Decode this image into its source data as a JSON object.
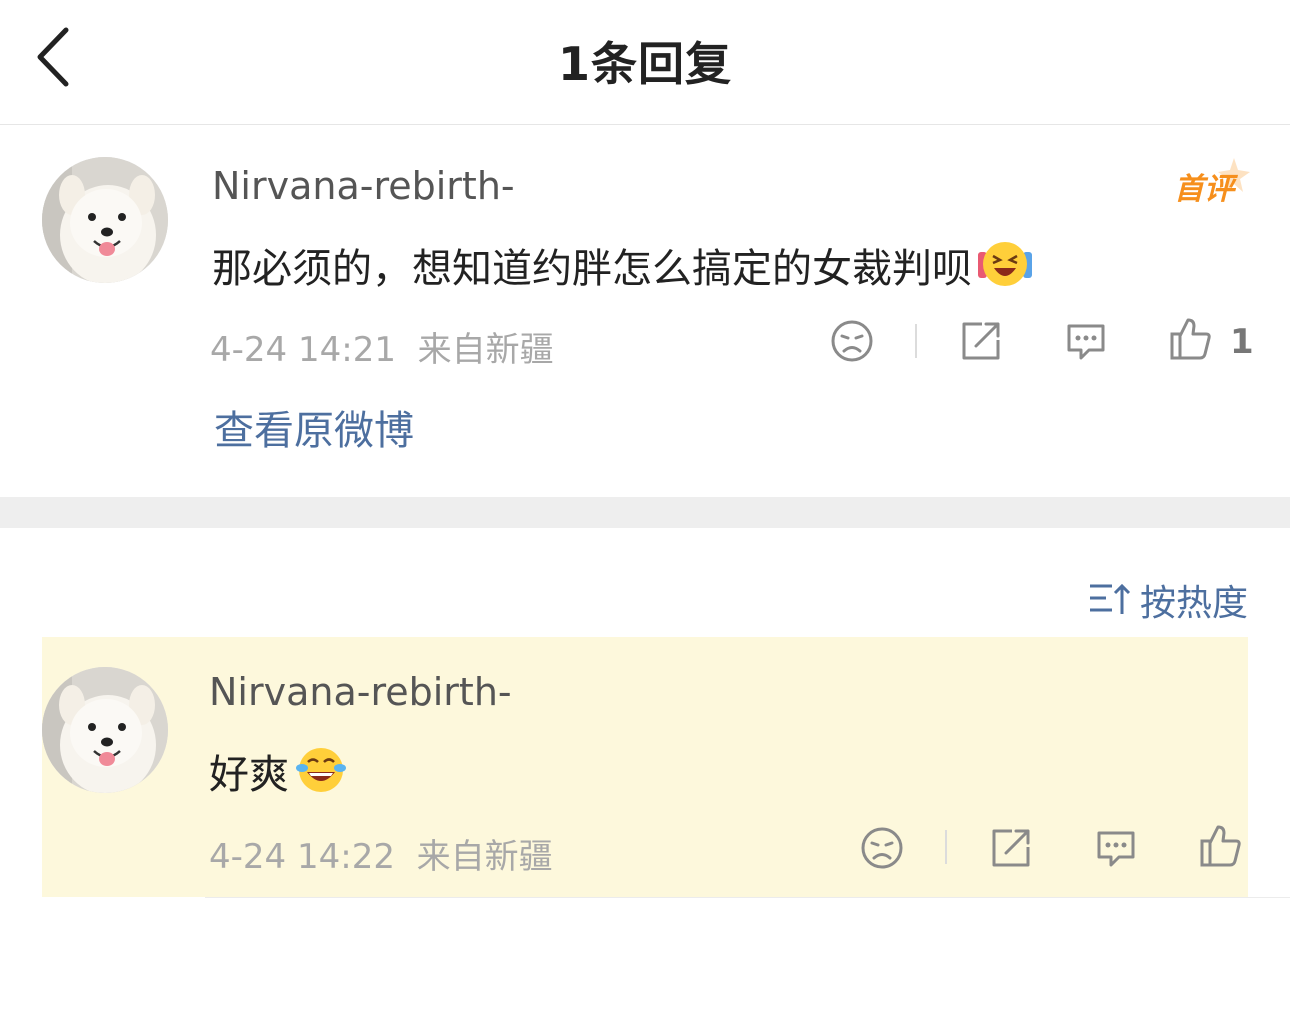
{
  "header": {
    "title": "1条回复"
  },
  "main_comment": {
    "username": "Nirvana-rebirth-",
    "text": "那必须的，想知道约胖怎么搞定的女裁判呗",
    "emoji_icon": "laughing-excited-emoji",
    "timestamp": "4-24 14:21",
    "location": "来自新疆",
    "like_count": "1",
    "badge": "首评",
    "view_original_label": "查看原微博"
  },
  "sort": {
    "label": "按热度"
  },
  "reply": {
    "username": "Nirvana-rebirth-",
    "text": "好爽",
    "emoji_icon": "tears-of-joy-emoji",
    "timestamp": "4-24 14:22",
    "location": "来自新疆"
  },
  "colors": {
    "link_blue": "#4d6f9f",
    "badge_orange": "#f68f1c",
    "highlight_bg": "#fdf8dc"
  }
}
